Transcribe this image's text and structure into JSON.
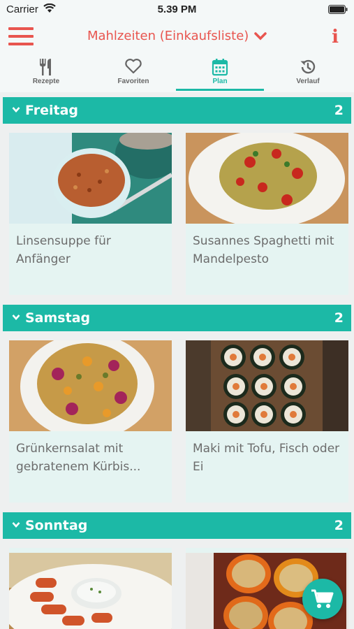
{
  "status_bar": {
    "carrier": "Carrier",
    "time": "5.39 PM"
  },
  "header": {
    "title": "Mahlzeiten (Einkaufsliste)"
  },
  "tabs": [
    {
      "label": "Rezepte",
      "icon": "fork-knife-icon",
      "active": false
    },
    {
      "label": "Favoriten",
      "icon": "heart-icon",
      "active": false
    },
    {
      "label": "Plan",
      "icon": "calendar-icon",
      "active": true
    },
    {
      "label": "Verlauf",
      "icon": "history-icon",
      "active": false
    }
  ],
  "days": [
    {
      "label": "Freitag",
      "count": "2",
      "recipes": [
        {
          "title": "Linsensuppe für Anfänger",
          "image": "lentil-soup-photo"
        },
        {
          "title": "Susannes Spaghetti mit Mandelpesto",
          "image": "spaghetti-pesto-photo"
        }
      ]
    },
    {
      "label": "Samstag",
      "count": "2",
      "recipes": [
        {
          "title": "Grünkernsalat mit gebratenem Kürbis...",
          "image": "spelt-salad-photo"
        },
        {
          "title": "Maki mit Tofu, Fisch oder Ei",
          "image": "maki-photo"
        }
      ]
    },
    {
      "label": "Sonntag",
      "count": "2",
      "recipes": [
        {
          "title": "",
          "image": "dip-plate-photo"
        },
        {
          "title": "",
          "image": "stuffed-peppers-photo"
        }
      ]
    }
  ],
  "colors": {
    "accent": "#1cb9a6",
    "brand_red": "#e8554f",
    "card_bg": "#e5f4f2"
  },
  "fab": {
    "icon": "shopping-cart-icon"
  }
}
